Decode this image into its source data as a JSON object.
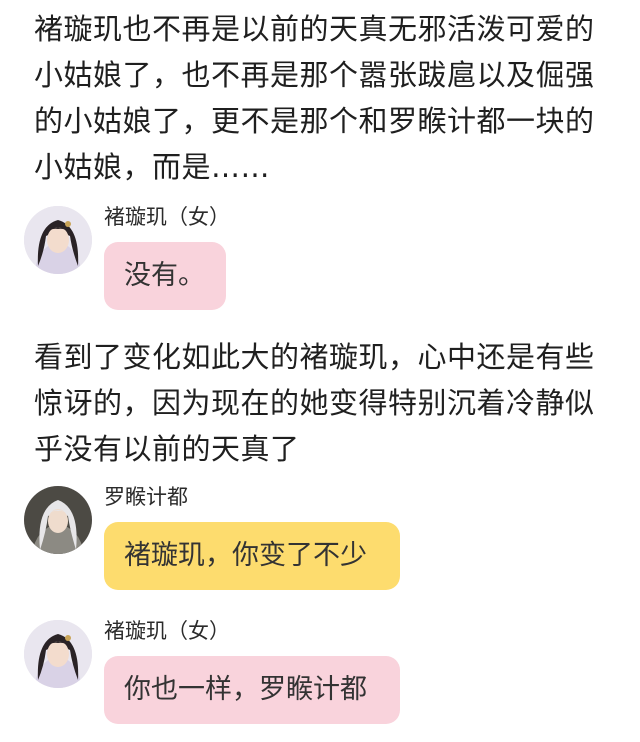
{
  "paragraphs": [
    "褚璇玑也不再是以前的天真无邪活泼可爱的小姑娘了，也不再是那个嚣张跋扈以及倔强的小姑娘了，更不是那个和罗睺计都一块的小姑娘，而是……",
    "看到了变化如此大的褚璇玑，心中还是有些惊讶的，因为现在的她变得特别沉着冷静似乎没有以前的天真了"
  ],
  "messages": [
    {
      "sender": "褚璇玑（女）",
      "text": "没有。",
      "bubble_color": "#f9d3dc",
      "avatar": "female-avatar"
    },
    {
      "sender": "罗睺计都",
      "text": "褚璇玑，你变了不少",
      "bubble_color": "#fddc6e",
      "avatar": "male-avatar"
    },
    {
      "sender": "褚璇玑（女）",
      "text": "你也一样，罗睺计都",
      "bubble_color": "#f9d3dc",
      "avatar": "female-avatar"
    }
  ]
}
